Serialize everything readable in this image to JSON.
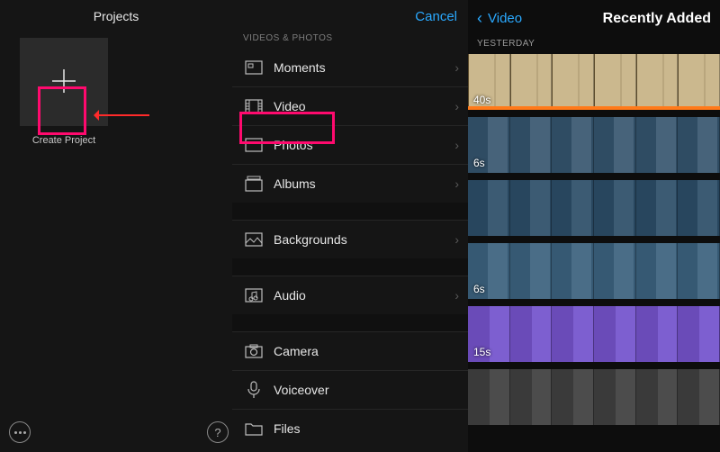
{
  "left": {
    "title": "Projects",
    "create_label": "Create Project"
  },
  "middle": {
    "cancel": "Cancel",
    "section": "VIDEOS & PHOTOS",
    "items": [
      {
        "label": "Moments"
      },
      {
        "label": "Video"
      },
      {
        "label": "Photos"
      },
      {
        "label": "Albums"
      }
    ],
    "single1": {
      "label": "Backgrounds"
    },
    "single2": {
      "label": "Audio"
    },
    "extras": [
      {
        "label": "Camera"
      },
      {
        "label": "Voiceover"
      },
      {
        "label": "Files"
      }
    ]
  },
  "right": {
    "back": "Video",
    "title": "Recently Added",
    "section": "YESTERDAY",
    "clips": [
      {
        "dur": "40s"
      },
      {
        "dur": "6s"
      },
      {
        "dur": ""
      },
      {
        "dur": "6s"
      },
      {
        "dur": "15s"
      },
      {
        "dur": ""
      }
    ]
  }
}
